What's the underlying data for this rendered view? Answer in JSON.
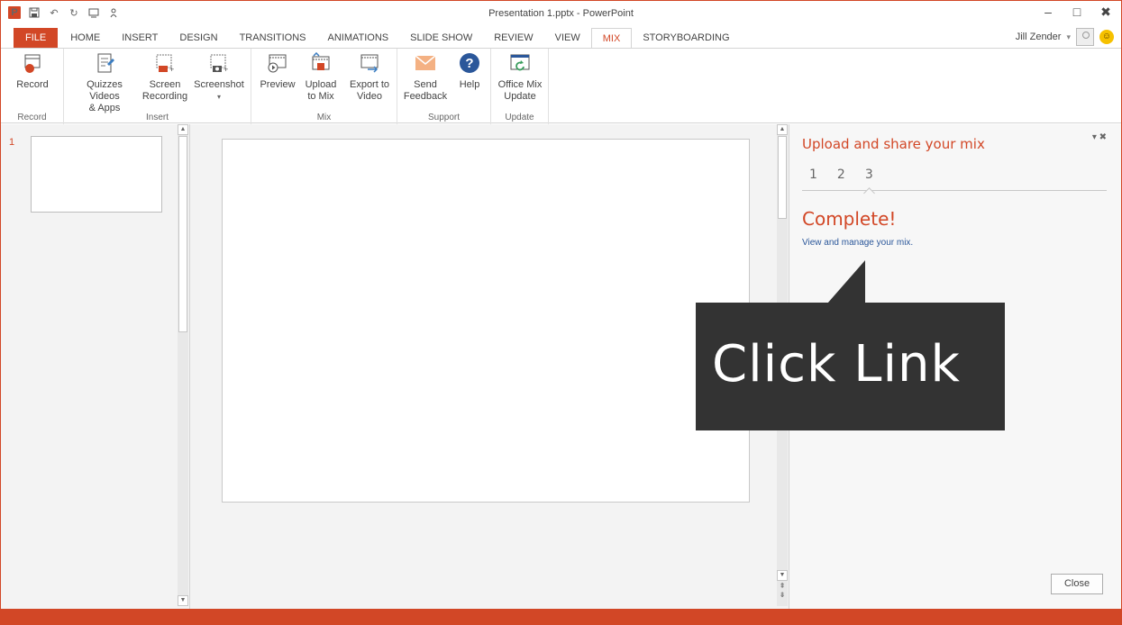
{
  "window": {
    "title": "Presentation 1.pptx - PowerPoint",
    "buttons": [
      "–",
      "□",
      "✖"
    ]
  },
  "quick_access": [
    {
      "icon": "powerpoint-logo-icon"
    },
    {
      "icon": "save-icon"
    },
    {
      "icon": "undo-icon"
    },
    {
      "icon": "redo-icon"
    },
    {
      "icon": "touch-mode-icon"
    },
    {
      "icon": "present-icon"
    }
  ],
  "tabs": [
    "FILE",
    "HOME",
    "INSERT",
    "DESIGN",
    "TRANSITIONS",
    "ANIMATIONS",
    "SLIDE SHOW",
    "REVIEW",
    "VIEW",
    "MIX",
    "STORYBOARDING"
  ],
  "active_tab": "MIX",
  "user": {
    "name": "Jill Zender",
    "dropdown": "▾"
  },
  "ribbon": {
    "record_group": {
      "label": "Record",
      "record_label": "Record"
    },
    "insert_group": {
      "label": "Insert",
      "quizzes_label_1": "Quizzes Videos",
      "quizzes_label_2": "& Apps",
      "screen_rec_label_1": "Screen",
      "screen_rec_label_2": "Recording",
      "screenshot_label": "Screenshot",
      "screenshot_caret": "▾"
    },
    "mix_group": {
      "label": "Mix",
      "preview_label": "Preview",
      "upload_label_1": "Upload",
      "upload_label_2": "to Mix",
      "export_label_1": "Export to",
      "export_label_2": "Video"
    },
    "support_group": {
      "label": "Support",
      "feedback_label_1": "Send",
      "feedback_label_2": "Feedback",
      "help_label": "Help"
    },
    "update_group": {
      "label": "Update",
      "office_mix_label_1": "Office Mix",
      "office_mix_label_2": "Update"
    }
  },
  "slides": [
    {
      "number": "1"
    }
  ],
  "task_pane": {
    "title": "Upload and share your mix",
    "controls": "▾ ✖",
    "steps": [
      "1",
      "2",
      "3"
    ],
    "current_step": "3",
    "complete": "Complete!",
    "link": "View and manage your mix.",
    "close_label": "Close"
  },
  "callout": {
    "text": "Click Link"
  },
  "colors": {
    "accent": "#d24726",
    "callout": "#333333",
    "link": "#2b579a"
  }
}
